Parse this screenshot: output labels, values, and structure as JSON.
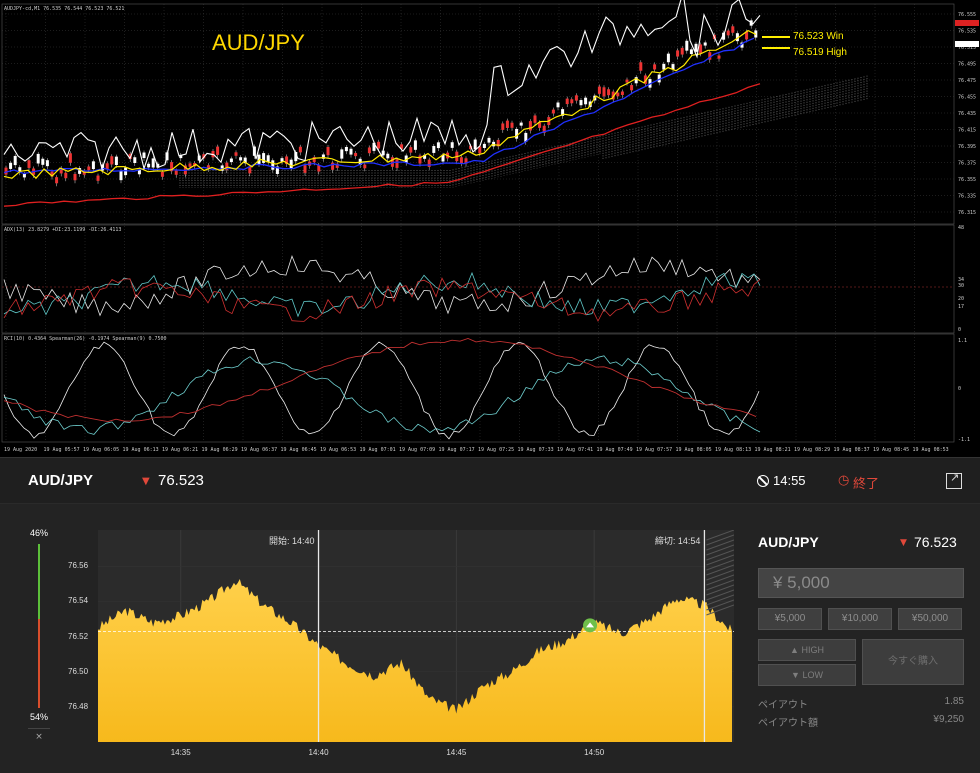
{
  "mt4": {
    "header": "AUDJPY-cd,M1  76.535 76.544 76.523 76.521",
    "pair_label": "AUD/JPY",
    "ann_win": "76.523  Win",
    "ann_high": "76.519  High",
    "price_axis": [
      "76.555",
      "76.535",
      "76.515",
      "76.495",
      "76.475",
      "76.455",
      "76.435",
      "76.415",
      "76.395",
      "76.375",
      "76.355",
      "76.335",
      "76.315"
    ],
    "adx_header": "ADX(13) 23.8279  +DI:23.1199  -DI:26.4113",
    "adx_axis": [
      "48",
      "34",
      "30",
      "20",
      "17",
      "0"
    ],
    "rci_header": "RCI(10) 0.4364  Spearman(26) -0.1974  Spearman(9) 0.7500",
    "rci_axis": [
      "1.1",
      "0",
      "-1.1"
    ],
    "time_axis": [
      "19 Aug 2020",
      "19 Aug 05:57",
      "19 Aug 06:05",
      "19 Aug 06:13",
      "19 Aug 06:21",
      "19 Aug 06:29",
      "19 Aug 06:37",
      "19 Aug 06:45",
      "19 Aug 06:53",
      "19 Aug 07:01",
      "19 Aug 07:09",
      "19 Aug 07:17",
      "19 Aug 07:25",
      "19 Aug 07:33",
      "19 Aug 07:41",
      "19 Aug 07:49",
      "19 Aug 07:57",
      "19 Aug 08:05",
      "19 Aug 08:13",
      "19 Aug 08:21",
      "19 Aug 08:29",
      "19 Aug 08:37",
      "19 Aug 08:45",
      "19 Aug 08:53"
    ]
  },
  "topbar": {
    "pair": "AUD/JPY",
    "rate": "76.523",
    "time": "14:55",
    "end": "終了"
  },
  "gauge": {
    "high_pct": "46%",
    "low_pct": "54%",
    "close": "×",
    "high_fraction": 0.46,
    "low_fraction": 0.54
  },
  "chart": {
    "start_label": "開始: 14:40",
    "end_label": "締切: 14:54",
    "y_ticks": [
      "76.56",
      "76.54",
      "76.52",
      "76.50",
      "76.48"
    ],
    "x_ticks": [
      "14:35",
      "14:40",
      "14:45",
      "14:50"
    ],
    "entry_rate": 76.523,
    "colors": {
      "area": "#f7b91c",
      "area_top": "#ffd04a",
      "bg": "#2b2b2b",
      "marker": "#6fbf4a"
    }
  },
  "chart_data": {
    "type": "area",
    "title": "",
    "xlabel": "",
    "ylabel": "",
    "ylim": [
      76.46,
      76.575
    ],
    "x": [
      "14:32",
      "14:33",
      "14:34",
      "14:35",
      "14:36",
      "14:37",
      "14:38",
      "14:39",
      "14:40",
      "14:41",
      "14:42",
      "14:43",
      "14:44",
      "14:45",
      "14:46",
      "14:47",
      "14:48",
      "14:49",
      "14:50",
      "14:51",
      "14:52",
      "14:53",
      "14:54",
      "14:55"
    ],
    "series": [
      {
        "values": [
          76.525,
          76.535,
          76.528,
          76.532,
          76.54,
          76.552,
          76.538,
          76.528,
          76.515,
          76.505,
          76.498,
          76.505,
          76.485,
          76.478,
          76.492,
          76.5,
          76.512,
          76.518,
          76.528,
          76.522,
          76.53,
          76.542,
          76.538,
          76.523
        ]
      }
    ]
  },
  "panel": {
    "pair": "AUD/JPY",
    "rate": "76.523",
    "amount_placeholder": "¥ 5,000",
    "chips": [
      "¥5,000",
      "¥10,000",
      "¥50,000"
    ],
    "high": "HIGH",
    "low": "LOW",
    "buy_now": "今すぐ購入",
    "payout_label": "ペイアウト",
    "payout_value": "1.85",
    "payout_amount_label": "ペイアウト額",
    "payout_amount_value": "¥9,250"
  }
}
